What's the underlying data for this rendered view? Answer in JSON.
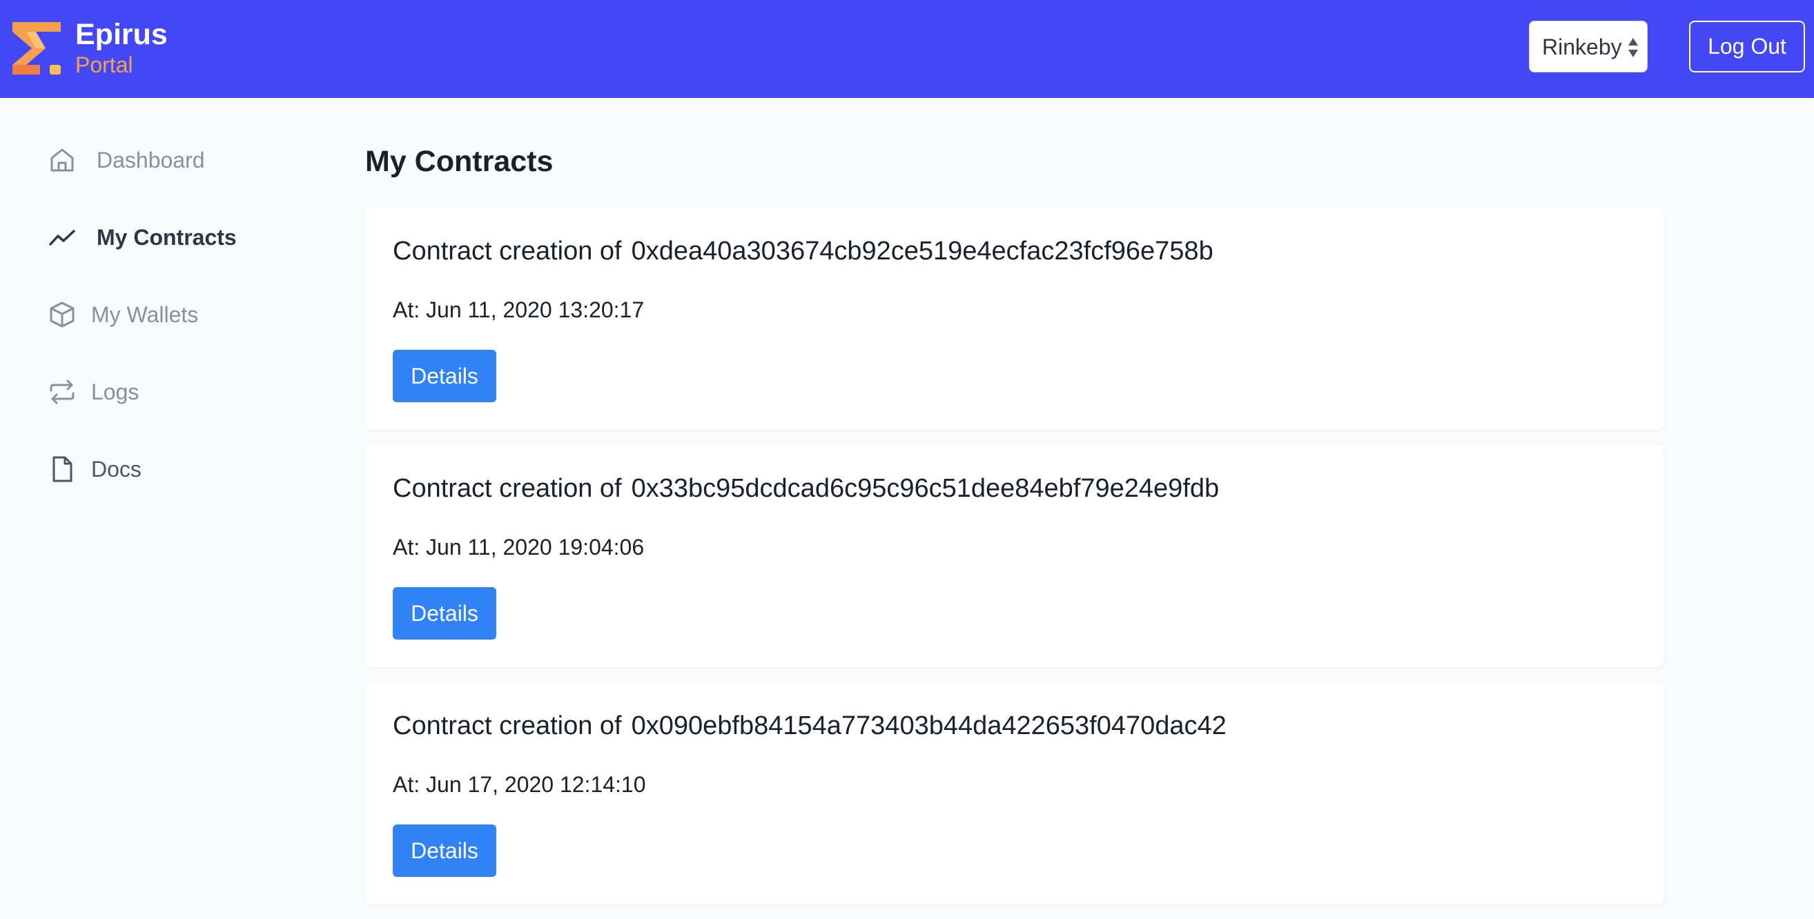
{
  "header": {
    "brand_name": "Epirus",
    "brand_sub": "Portal",
    "network": "Rinkeby",
    "logout_label": "Log Out",
    "colors": {
      "bar": "#4447f5",
      "brand_sub": "#f6a04d"
    }
  },
  "sidebar": {
    "items": [
      {
        "label": "Dashboard",
        "icon": "home-icon",
        "active": false
      },
      {
        "label": "My Contracts",
        "icon": "trending-icon",
        "active": true
      },
      {
        "label": "My Wallets",
        "icon": "cube-icon",
        "active": false
      },
      {
        "label": "Logs",
        "icon": "repeat-icon",
        "active": false
      },
      {
        "label": "Docs",
        "icon": "document-icon",
        "active": false
      }
    ]
  },
  "main": {
    "title": "My Contracts",
    "contracts": [
      {
        "title_prefix": "Contract creation of",
        "address": "0xdea40a303674cb92ce519e4ecfac23fcf96e758b",
        "time": "At: Jun 11, 2020 13:20:17",
        "button": "Details"
      },
      {
        "title_prefix": "Contract creation of",
        "address": "0x33bc95dcdcad6c95c96c51dee84ebf79e24e9fdb",
        "time": "At: Jun 11, 2020 19:04:06",
        "button": "Details"
      },
      {
        "title_prefix": "Contract creation of",
        "address": "0x090ebfb84154a773403b44da422653f0470dac42",
        "time": "At: Jun 17, 2020 12:14:10",
        "button": "Details"
      }
    ],
    "colors": {
      "button": "#3182f6"
    }
  }
}
